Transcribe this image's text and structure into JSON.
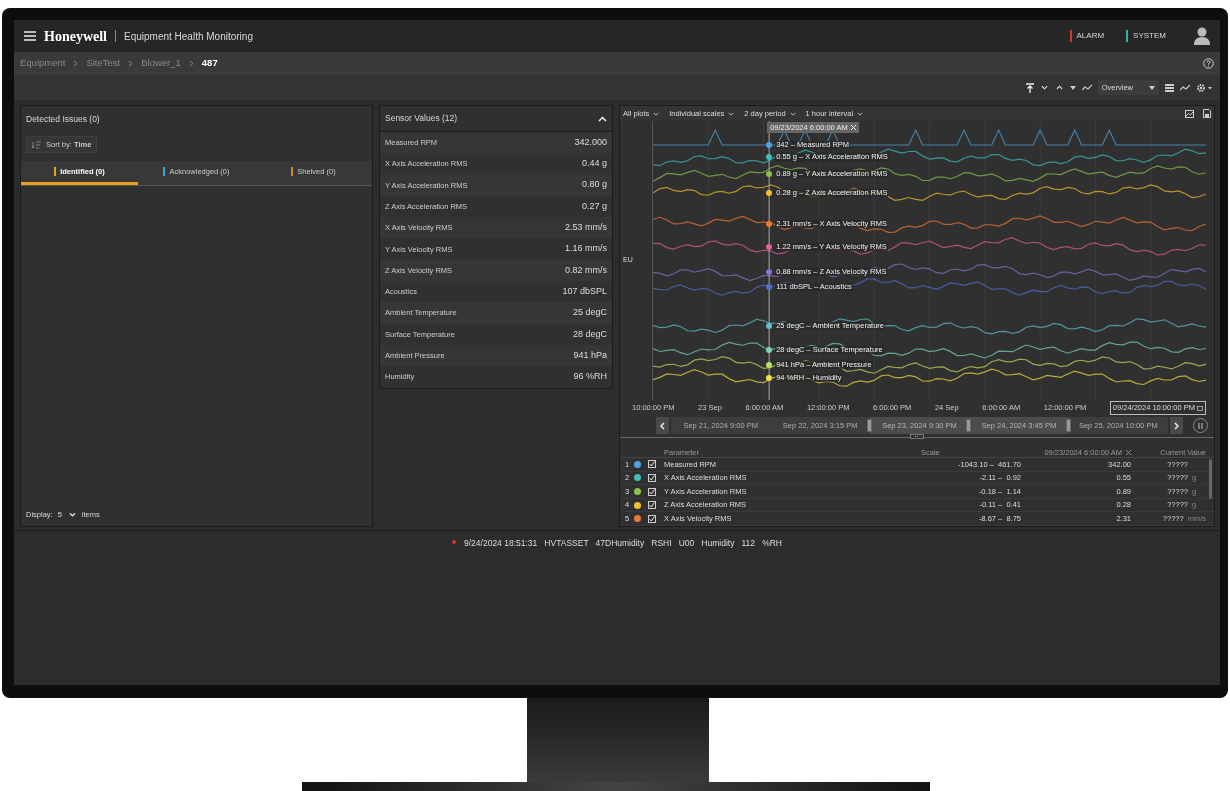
{
  "header": {
    "brand": "Honeywell",
    "app_title": "Equipment Health Monitoring",
    "indicators": [
      {
        "label": "ALARM",
        "color": "#d9342b"
      },
      {
        "label": "SYSTEM",
        "color": "#2fb0a8"
      }
    ]
  },
  "breadcrumb": [
    {
      "label": "Equipment",
      "current": false
    },
    {
      "label": "SiteTest",
      "current": false
    },
    {
      "label": "Blower_1",
      "current": false
    },
    {
      "label": "487",
      "current": true
    }
  ],
  "toolbar": {
    "view_select": "Overview"
  },
  "issues": {
    "title": "Detected Issues (0)",
    "sort": "Sort by: **Time**",
    "tabs": [
      {
        "label": "Identified (0)",
        "color": "#e8a020",
        "selected": true
      },
      {
        "label": "Acknowledged (0)",
        "color": "#2ea8e0",
        "selected": false
      },
      {
        "label": "Shelved (0)",
        "color": "#d08a20",
        "selected": false
      }
    ],
    "display": {
      "label": "Display:",
      "value": "5",
      "suffix": "items"
    }
  },
  "sensors": {
    "title": "Sensor Values (12)",
    "rows": [
      {
        "name": "Measured RPM",
        "value": "342.000"
      },
      {
        "name": "X Axis Acceleration RMS",
        "value": "0.44 g"
      },
      {
        "name": "Y Axis Acceleration RMS",
        "value": "0.80 g"
      },
      {
        "name": "Z Axis Acceleration RMS",
        "value": "0.27 g"
      },
      {
        "name": "X Axis Velocity RMS",
        "value": "2.53 mm/s"
      },
      {
        "name": "Y Axis Velocity RMS",
        "value": "1.16 mm/s"
      },
      {
        "name": "Z Axis Velocity RMS",
        "value": "0.82 mm/s"
      },
      {
        "name": "Acoustics",
        "value": "107 dbSPL"
      },
      {
        "name": "Ambient Temperature",
        "value": "25 degC"
      },
      {
        "name": "Surface Temperature",
        "value": "28 degC"
      },
      {
        "name": "Ambient Pressure",
        "value": "941 hPa"
      },
      {
        "name": "Humidity",
        "value": "96 %RH"
      }
    ]
  },
  "chart": {
    "filters": [
      "All plots",
      "Individual scales",
      "2 day period",
      "1 hour interval"
    ],
    "y_label": "EU",
    "cursor_label": "09/23/2024 6:00:00 AM",
    "series": [
      {
        "label": "342 – Measured RPM",
        "color": "#4fa3e0",
        "kind": "spiky"
      },
      {
        "label": "0.55 g – X Axis Acceleration RMS",
        "color": "#3cc0c0",
        "kind": "trend"
      },
      {
        "label": "0.89 g – Y Axis Acceleration RMS",
        "color": "#8bc34a",
        "kind": "trend"
      },
      {
        "label": "0.28 g – Z Axis Acceleration RMS",
        "color": "#f0c030",
        "kind": "trend"
      },
      {
        "label": "2.31 mm/s – X Axis Velocity RMS",
        "color": "#f07830",
        "kind": "trend"
      },
      {
        "label": "1.22 mm/s – Y Axis Velocity RMS",
        "color": "#e060a0",
        "kind": "trend"
      },
      {
        "label": "0.88 mm/s – Z Axis Velocity RMS",
        "color": "#9070d0",
        "kind": "trend"
      },
      {
        "label": "111 dbSPL – Acoustics",
        "color": "#5070d0",
        "kind": "trend"
      },
      {
        "label": "25 degC – Ambient Temperature",
        "color": "#60c0d0",
        "kind": "trend"
      },
      {
        "label": "28 degC – Surface Temperature",
        "color": "#80d0c0",
        "kind": "trend"
      },
      {
        "label": "941 hPa – Ambient Pressure",
        "color": "#c0e060",
        "kind": "trend"
      },
      {
        "label": "94 %RH – Humidity",
        "color": "#f0e040",
        "kind": "trend"
      }
    ],
    "x_ticks": [
      "10:00:00 PM",
      "23 Sep",
      "6:00:00 AM",
      "12:00:00 PM",
      "6:00:00 PM",
      "24 Sep",
      "6:00:00 AM",
      "12:00:00 PM"
    ],
    "end_date": "09/24/2024 10:00:00 PM",
    "timeline": [
      "Sep 21, 2024 9:00 PM",
      "Sep 22, 2024 3:15 PM",
      "Sep 23, 2024 9:30 PM",
      "Sep 24, 2024 3:45 PM",
      "Sep 25, 2024 10:00 PM"
    ]
  },
  "table": {
    "columns": [
      "Parameter",
      "Scale",
      "09/23/2024 6:00:00 AM",
      "Current Value"
    ],
    "rows": [
      {
        "index": "1",
        "color": "#4fa3e0",
        "checked": true,
        "name": "Measured RPM",
        "scale": "-1043.10 –  461.70",
        "cursor_value": "342.00",
        "current_value": "?????"
      },
      {
        "index": "2",
        "color": "#3cc0c0",
        "checked": true,
        "name": "X Axis Acceleration RMS",
        "scale": "-2.11 –  0.92",
        "cursor_value": "0.55",
        "current_value": "?????",
        "unit": "g"
      },
      {
        "index": "3",
        "color": "#8bc34a",
        "checked": true,
        "name": "Y Axis Acceleration RMS",
        "scale": "-0.18 –  1.14",
        "cursor_value": "0.89",
        "current_value": "?????",
        "unit": "g"
      },
      {
        "index": "4",
        "color": "#f0c030",
        "checked": true,
        "name": "Z Axis Acceleration RMS",
        "scale": "-0.11 –  0.41",
        "cursor_value": "0.28",
        "current_value": "?????",
        "unit": "g"
      },
      {
        "index": "5",
        "color": "#f07830",
        "checked": true,
        "name": "X Axis Velocity RMS",
        "scale": "-8.67 –  8.75",
        "cursor_value": "2.31",
        "current_value": "?????",
        "unit": "mm/s"
      }
    ]
  },
  "status_bar": {
    "color": "#d03030",
    "message": "9/24/2024 18:51:31   HVTASSET   47DHumidity   RSHI   U00   Humidity   112   %RH"
  }
}
